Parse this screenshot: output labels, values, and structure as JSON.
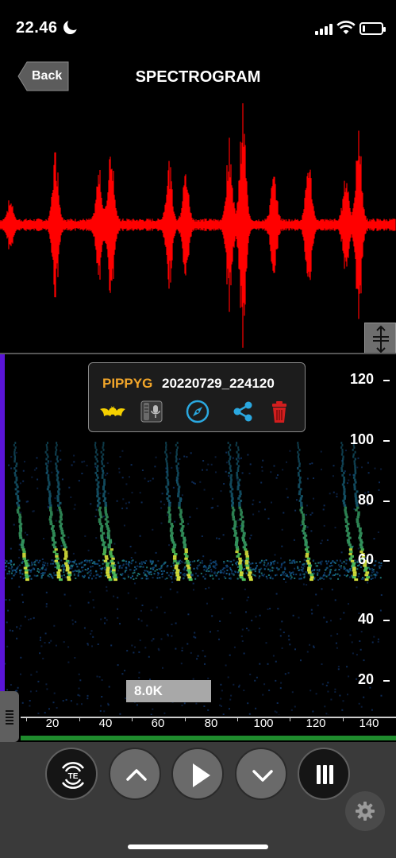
{
  "status_bar": {
    "time": "22.46",
    "battery_level": 0.15
  },
  "nav": {
    "back_label": "Back",
    "title": "SPECTROGRAM"
  },
  "popup": {
    "species": "PIPPYG",
    "file_name": "20220729_224120",
    "icons": [
      "bat-icon",
      "microphone-info-icon",
      "compass-icon",
      "share-icon",
      "trash-icon"
    ]
  },
  "spectrogram": {
    "y_axis_labels": [
      "120",
      "100",
      "80",
      "60",
      "40",
      "20"
    ],
    "x_axis_labels": [
      "20",
      "40",
      "60",
      "80",
      "100",
      "120",
      "140"
    ],
    "freq_readout": "8.0K"
  },
  "toolbar": {
    "buttons": [
      "te-trigger-button",
      "up-button",
      "play-button",
      "down-button",
      "pause-bars-button",
      "settings-button"
    ],
    "te_label": "TE"
  },
  "colors": {
    "waveform": "#ff0000",
    "species": "#f2a62a",
    "cursor": "#5a14d8",
    "progress": "#1f8b2d",
    "accent_icon": "#2aa8e0",
    "bat_icon": "#f5d000",
    "trash_icon": "#d21e1e"
  }
}
